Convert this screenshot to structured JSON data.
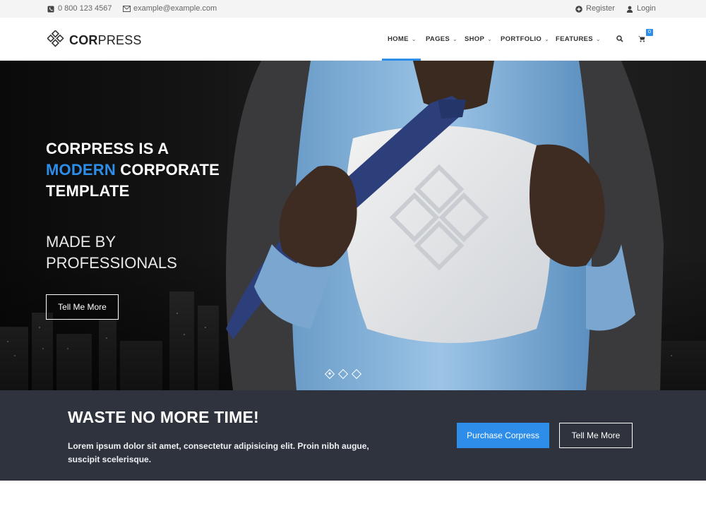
{
  "topbar": {
    "phone": "0 800 123 4567",
    "email": "example@example.com",
    "register_label": "Register",
    "login_label": "Login"
  },
  "header": {
    "logo_bold": "COR",
    "logo_rest": "PRESS",
    "nav": [
      {
        "label": "HOME",
        "active": true
      },
      {
        "label": "PAGES"
      },
      {
        "label": "SHOP"
      },
      {
        "label": "PORTFOLIO"
      },
      {
        "label": "FEATURES"
      }
    ],
    "cart_count": "0"
  },
  "hero": {
    "title_line1": "CORPRESS IS A",
    "title_accent": "MODERN",
    "title_line2_rest": " CORPORATE",
    "title_line3": "TEMPLATE",
    "subtitle_line1": "MADE BY",
    "subtitle_line2": "PROFESSIONALS",
    "button_label": "Tell Me More",
    "slides_count": 3,
    "active_slide": 1
  },
  "cta": {
    "title": "WASTE NO MORE TIME!",
    "text": "Lorem ipsum dolor sit amet, consectetur adipisicing elit. Proin nibh augue, suscipit scelerisque.",
    "primary_label": "Purchase Corpress",
    "secondary_label": "Tell Me More"
  },
  "colors": {
    "accent": "#2d8de8",
    "cta_bg": "#2e333d",
    "topbar_bg": "#f4f4f4"
  },
  "icons": {
    "phone": "phone-icon",
    "email": "envelope-icon",
    "register": "plus-circle-icon",
    "login": "user-icon",
    "search": "search-icon",
    "cart": "cart-icon",
    "logo": "diamond-grid-icon"
  }
}
